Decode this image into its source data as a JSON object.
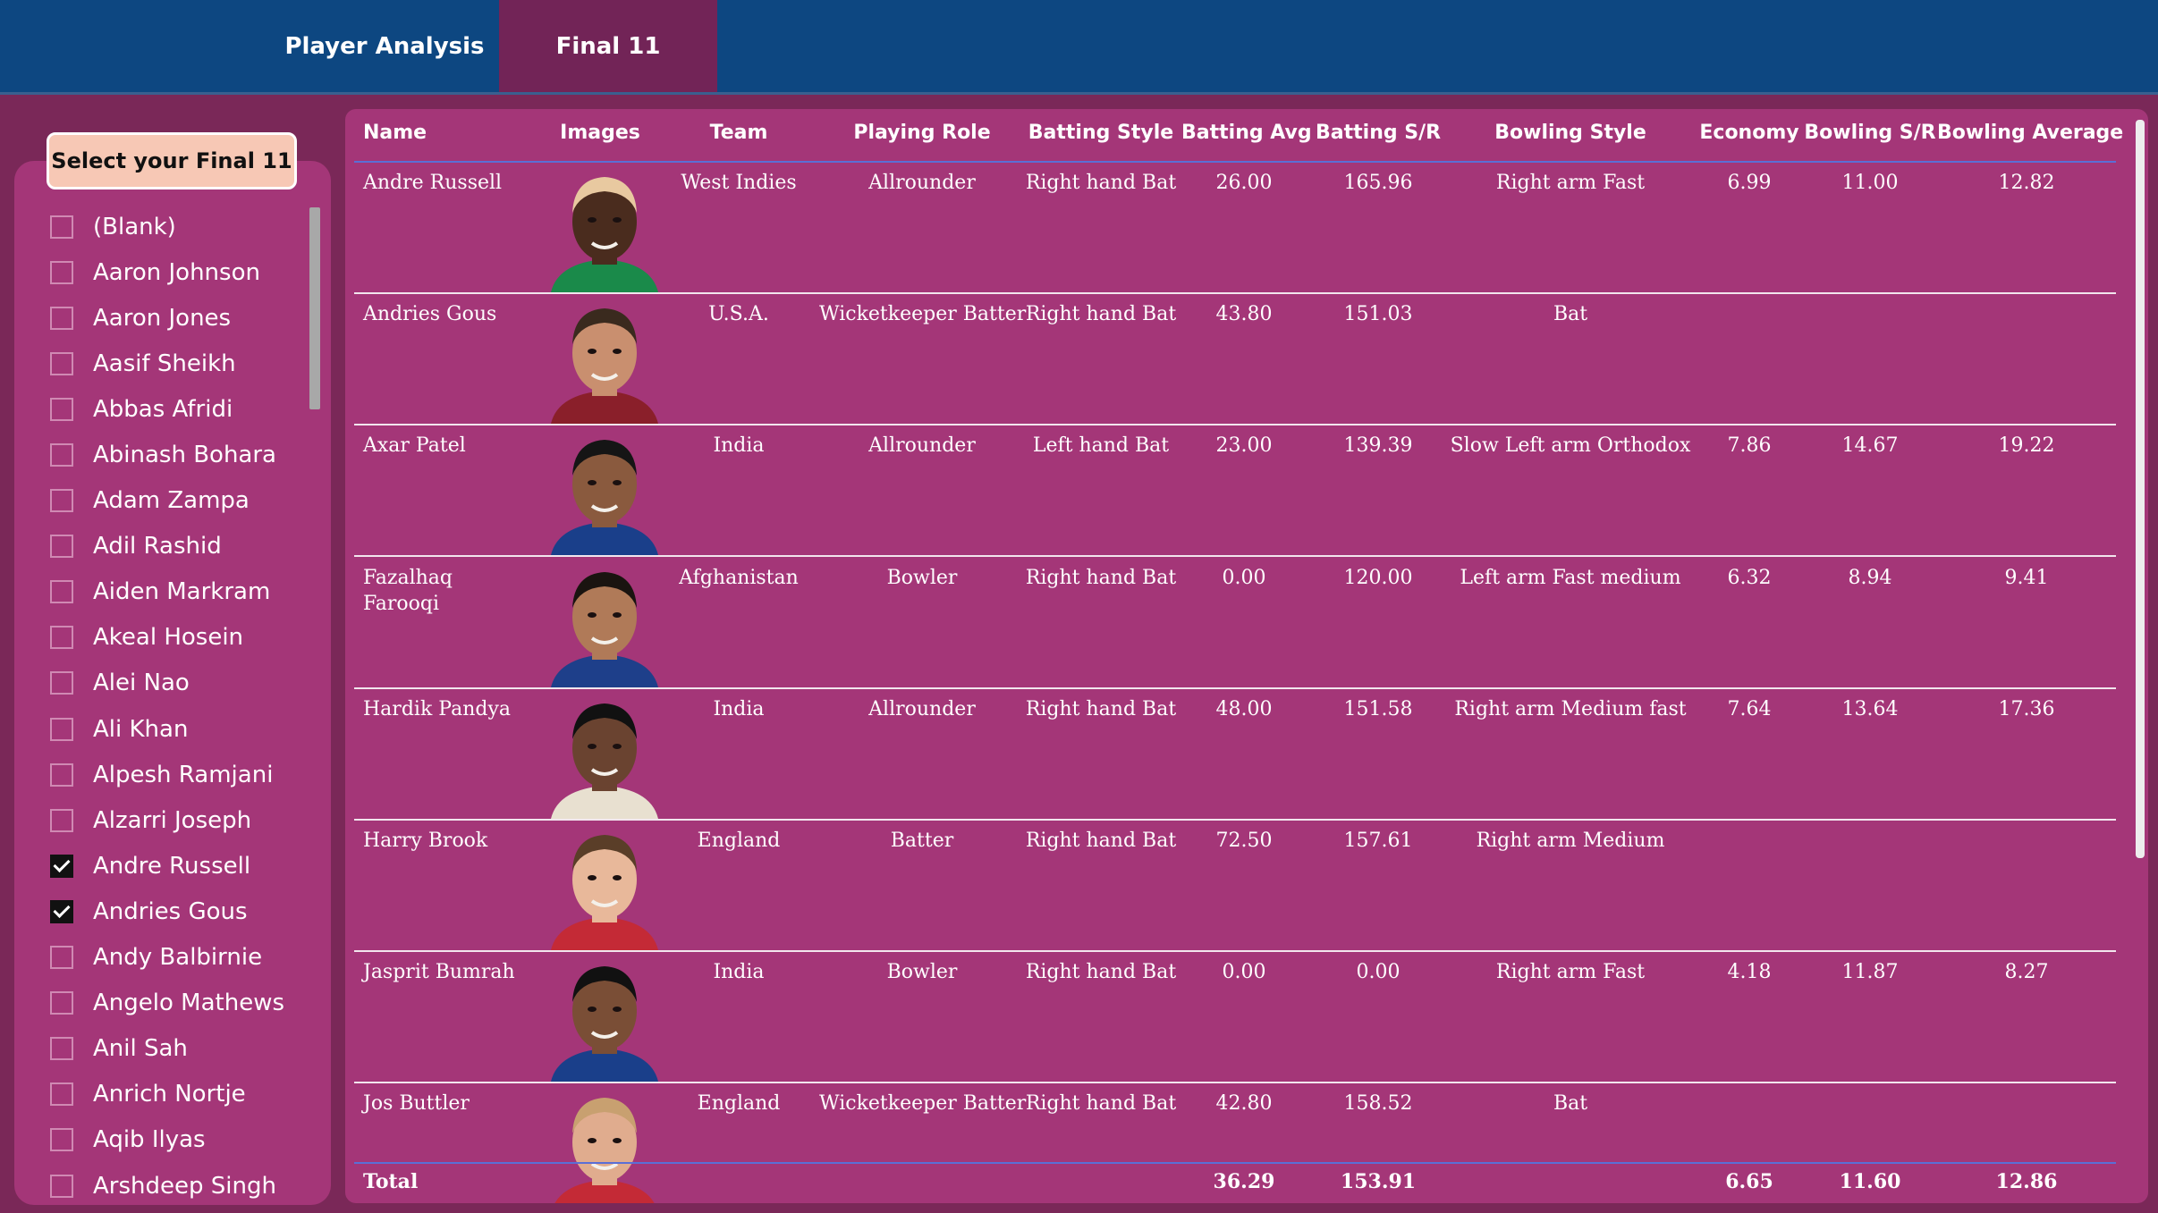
{
  "nav": {
    "tabs": [
      {
        "label": "Player Analysis"
      },
      {
        "label": "Final 11"
      }
    ]
  },
  "slicer": {
    "title": "Select your Final 11",
    "items": [
      {
        "label": "(Blank)",
        "checked": false
      },
      {
        "label": "Aaron Johnson",
        "checked": false
      },
      {
        "label": "Aaron Jones",
        "checked": false
      },
      {
        "label": "Aasif Sheikh",
        "checked": false
      },
      {
        "label": "Abbas Afridi",
        "checked": false
      },
      {
        "label": "Abinash Bohara",
        "checked": false
      },
      {
        "label": "Adam Zampa",
        "checked": false
      },
      {
        "label": "Adil Rashid",
        "checked": false
      },
      {
        "label": "Aiden Markram",
        "checked": false
      },
      {
        "label": "Akeal Hosein",
        "checked": false
      },
      {
        "label": "Alei Nao",
        "checked": false
      },
      {
        "label": "Ali Khan",
        "checked": false
      },
      {
        "label": "Alpesh Ramjani",
        "checked": false
      },
      {
        "label": "Alzarri Joseph",
        "checked": false
      },
      {
        "label": "Andre Russell",
        "checked": true
      },
      {
        "label": "Andries Gous",
        "checked": true
      },
      {
        "label": "Andy Balbirnie",
        "checked": false
      },
      {
        "label": "Angelo Mathews",
        "checked": false
      },
      {
        "label": "Anil Sah",
        "checked": false
      },
      {
        "label": "Anrich Nortje",
        "checked": false
      },
      {
        "label": "Aqib Ilyas",
        "checked": false
      },
      {
        "label": "Arshdeep Singh",
        "checked": false
      }
    ]
  },
  "table": {
    "headers": {
      "name": "Name",
      "images": "Images",
      "team": "Team",
      "role": "Playing Role",
      "batting_style": "Batting Style",
      "batting_avg": "Batting Avg",
      "batting_sr": "Batting S/R",
      "bowling_style": "Bowling Style",
      "economy": "Economy",
      "bowling_sr": "Bowling S/R",
      "bowling_avg": "Bowling Average"
    },
    "rows": [
      {
        "name": "Andre Russell",
        "team": "West Indies",
        "role": "Allrounder",
        "batting_style": "Right hand Bat",
        "batting_avg": "26.00",
        "batting_sr": "165.96",
        "bowling_style": "Right arm Fast",
        "economy": "6.99",
        "bowling_sr": "11.00",
        "bowling_avg": "12.82",
        "shirt": "#1a8a4a",
        "skin": "#4a2c1e",
        "hair": "#e8c9a0"
      },
      {
        "name": "Andries Gous",
        "team": "U.S.A.",
        "role": "Wicketkeeper Batter",
        "batting_style": "Right hand Bat",
        "batting_avg": "43.80",
        "batting_sr": "151.03",
        "bowling_style": "Bat",
        "economy": "",
        "bowling_sr": "",
        "bowling_avg": "",
        "shirt": "#8a1f2a",
        "skin": "#c98f6f",
        "hair": "#3a2a1e"
      },
      {
        "name": "Axar Patel",
        "team": "India",
        "role": "Allrounder",
        "batting_style": "Left hand Bat",
        "batting_avg": "23.00",
        "batting_sr": "139.39",
        "bowling_style": "Slow Left arm Orthodox",
        "economy": "7.86",
        "bowling_sr": "14.67",
        "bowling_avg": "19.22",
        "shirt": "#1a3f8a",
        "skin": "#8a5a3e",
        "hair": "#151515"
      },
      {
        "name": "Fazalhaq Farooqi",
        "team": "Afghanistan",
        "role": "Bowler",
        "batting_style": "Right hand Bat",
        "batting_avg": "0.00",
        "batting_sr": "120.00",
        "bowling_style": "Left arm Fast medium",
        "economy": "6.32",
        "bowling_sr": "8.94",
        "bowling_avg": "9.41",
        "shirt": "#1e3f8a",
        "skin": "#b07a58",
        "hair": "#1a1410"
      },
      {
        "name": "Hardik Pandya",
        "team": "India",
        "role": "Allrounder",
        "batting_style": "Right hand Bat",
        "batting_avg": "48.00",
        "batting_sr": "151.58",
        "bowling_style": "Right arm Medium fast",
        "economy": "7.64",
        "bowling_sr": "13.64",
        "bowling_avg": "17.36",
        "shirt": "#e8e0d0",
        "skin": "#6a4330",
        "hair": "#111111"
      },
      {
        "name": "Harry Brook",
        "team": "England",
        "role": "Batter",
        "batting_style": "Right hand Bat",
        "batting_avg": "72.50",
        "batting_sr": "157.61",
        "bowling_style": "Right arm Medium",
        "economy": "",
        "bowling_sr": "",
        "bowling_avg": "",
        "shirt": "#c42a36",
        "skin": "#e8b89a",
        "hair": "#5a3e28"
      },
      {
        "name": "Jasprit Bumrah",
        "team": "India",
        "role": "Bowler",
        "batting_style": "Right hand Bat",
        "batting_avg": "0.00",
        "batting_sr": "0.00",
        "bowling_style": "Right arm Fast",
        "economy": "4.18",
        "bowling_sr": "11.87",
        "bowling_avg": "8.27",
        "shirt": "#1a3f8a",
        "skin": "#7a4e36",
        "hair": "#111111"
      },
      {
        "name": "Jos Buttler",
        "team": "England",
        "role": "Wicketkeeper Batter",
        "batting_style": "Right hand Bat",
        "batting_avg": "42.80",
        "batting_sr": "158.52",
        "bowling_style": "Bat",
        "economy": "",
        "bowling_sr": "",
        "bowling_avg": "",
        "shirt": "#c42a36",
        "skin": "#e0ac8e",
        "hair": "#c8a070"
      }
    ],
    "totals": {
      "label": "Total",
      "batting_avg": "36.29",
      "batting_sr": "153.91",
      "economy": "6.65",
      "bowling_sr": "11.60",
      "bowling_avg": "12.86"
    }
  }
}
